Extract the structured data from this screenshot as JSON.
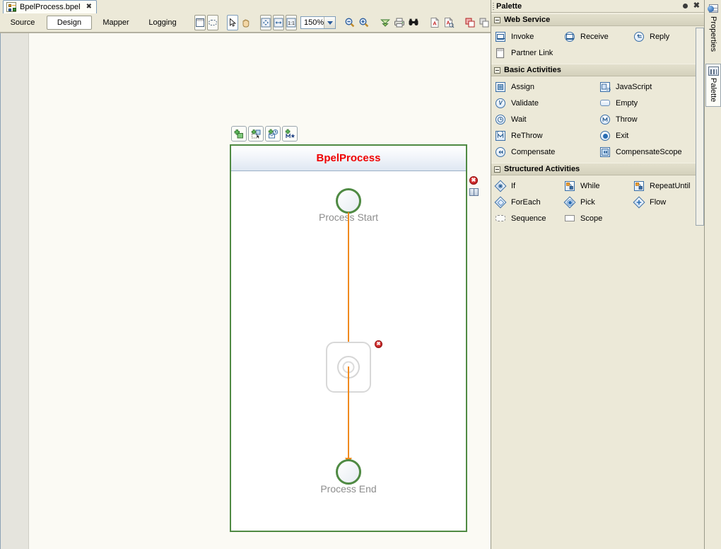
{
  "editor": {
    "tab": {
      "title": "BpelProcess.bpel",
      "close": "✖",
      "icon": "bpel-file-icon"
    },
    "modes": [
      {
        "label": "Source",
        "active": false
      },
      {
        "label": "Design",
        "active": true
      },
      {
        "label": "Mapper",
        "active": false
      },
      {
        "label": "Logging",
        "active": false
      }
    ],
    "toolbar": {
      "zoom_value": "150%",
      "buttons": [
        {
          "name": "show-properties-view-button",
          "icon": "panel-icon"
        },
        {
          "name": "marquee-select-button",
          "icon": "marquee-icon"
        },
        {
          "name": "select-tool-button",
          "icon": "cursor-arrow-icon"
        },
        {
          "name": "pan-tool-button",
          "icon": "hand-icon"
        },
        {
          "name": "zoom-fit-page-button",
          "icon": "fit-page-icon"
        },
        {
          "name": "zoom-fit-width-button",
          "icon": "fit-width-icon"
        },
        {
          "name": "zoom-actual-size-button",
          "icon": "one-to-one-icon"
        },
        {
          "name": "zoom-out-button",
          "icon": "zoom-out-icon"
        },
        {
          "name": "zoom-in-button",
          "icon": "zoom-in-icon"
        },
        {
          "name": "collapse-all-button",
          "icon": "collapse-chevron-icon"
        },
        {
          "name": "print-button",
          "icon": "printer-icon"
        },
        {
          "name": "validate-button",
          "icon": "binoculars-icon"
        },
        {
          "name": "export-pdf-button",
          "icon": "pdf-icon"
        },
        {
          "name": "export-pdf-preview-button",
          "icon": "pdf-preview-icon"
        },
        {
          "name": "copy-button",
          "icon": "copy-red-icon"
        },
        {
          "name": "duplicate-button",
          "icon": "copy-gray-icon"
        }
      ]
    },
    "add_toolbar": [
      {
        "name": "add-activity-button",
        "icon": "add-node-icon"
      },
      {
        "name": "add-scope-button",
        "icon": "add-scope-icon"
      },
      {
        "name": "add-event-handler-button",
        "icon": "add-event-icon"
      },
      {
        "name": "add-link-button",
        "icon": "add-link-icon"
      }
    ],
    "diagram": {
      "process_title": "BpelProcess",
      "start_label": "Process Start",
      "end_label": "Process End",
      "activity_name": "empty-activity-placeholder",
      "error_marker": "✖",
      "activity_error_marker": "✖",
      "accent_flow_color": "#f08a1e",
      "process_border_color": "#4f8a43",
      "title_color": "#ef0000",
      "markers": [
        {
          "name": "process-error-marker",
          "type": "error"
        },
        {
          "name": "process-documentation-marker",
          "type": "doc"
        }
      ]
    }
  },
  "palette": {
    "title": "Palette",
    "minimize_label": "●",
    "close_label": "✖",
    "drawers": [
      {
        "name": "web-service",
        "label": "Web Service",
        "expanded": true,
        "rows": [
          [
            {
              "label": "Invoke",
              "icon": "invoke-icon",
              "col": "c3"
            },
            {
              "label": "Receive",
              "icon": "receive-icon",
              "col": "c3"
            },
            {
              "label": "Reply",
              "icon": "reply-icon",
              "col": "c3"
            }
          ],
          [
            {
              "label": "Partner Link",
              "icon": "partner-link-icon",
              "col": "c2"
            }
          ]
        ]
      },
      {
        "name": "basic-activities",
        "label": "Basic Activities",
        "expanded": true,
        "rows": [
          [
            {
              "label": "Assign",
              "icon": "assign-icon",
              "col": "c2"
            },
            {
              "label": "JavaScript",
              "icon": "javascript-icon",
              "col": "c2"
            }
          ],
          [
            {
              "label": "Validate",
              "icon": "validate-icon",
              "col": "c2"
            },
            {
              "label": "Empty",
              "icon": "empty-icon",
              "col": "c2"
            }
          ],
          [
            {
              "label": "Wait",
              "icon": "wait-clock-icon",
              "col": "c2"
            },
            {
              "label": "Throw",
              "icon": "throw-icon",
              "col": "c2"
            }
          ],
          [
            {
              "label": "ReThrow",
              "icon": "rethrow-icon",
              "col": "c2"
            },
            {
              "label": "Exit",
              "icon": "exit-icon",
              "col": "c2"
            }
          ],
          [
            {
              "label": "Compensate",
              "icon": "compensate-icon",
              "col": "c2"
            },
            {
              "label": "CompensateScope",
              "icon": "compensate-scope-icon",
              "col": "c2"
            }
          ]
        ]
      },
      {
        "name": "structured-activities",
        "label": "Structured Activities",
        "expanded": true,
        "rows": [
          [
            {
              "label": "If",
              "icon": "if-icon",
              "col": "c3"
            },
            {
              "label": "While",
              "icon": "while-icon",
              "col": "c3"
            },
            {
              "label": "RepeatUntil",
              "icon": "repeat-until-icon",
              "col": "c3"
            }
          ],
          [
            {
              "label": "ForEach",
              "icon": "foreach-icon",
              "col": "c3"
            },
            {
              "label": "Pick",
              "icon": "pick-icon",
              "col": "c3"
            },
            {
              "label": "Flow",
              "icon": "flow-icon",
              "col": "c3"
            }
          ],
          [
            {
              "label": "Sequence",
              "icon": "sequence-icon",
              "col": "c3"
            },
            {
              "label": "Scope",
              "icon": "scope-icon",
              "col": "c3"
            }
          ]
        ]
      }
    ]
  },
  "side_tabs": [
    {
      "label": "Properties",
      "icon": "properties-icon",
      "selected": false
    },
    {
      "label": "Palette",
      "icon": "palette-icon",
      "selected": true
    }
  ]
}
